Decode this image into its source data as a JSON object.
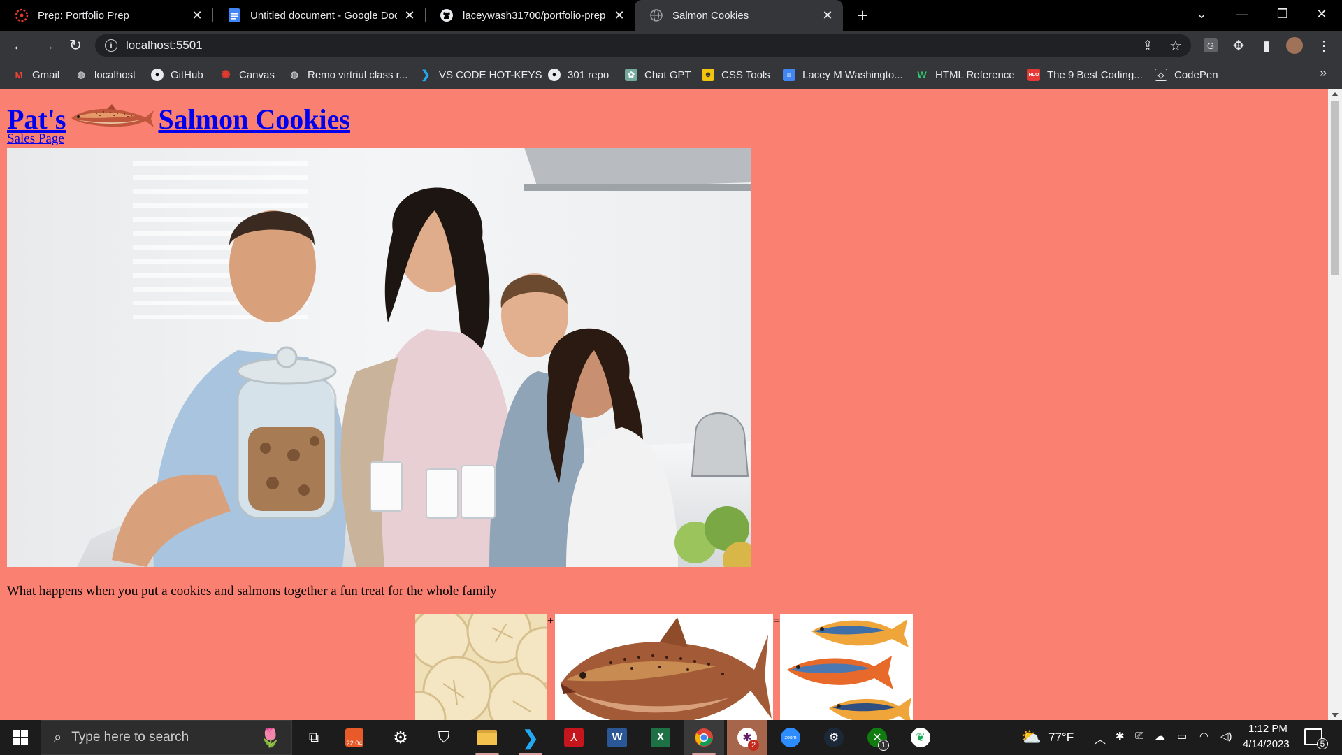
{
  "browser": {
    "tabs": [
      {
        "title": "Prep: Portfolio Prep",
        "icon": "canvas-icon",
        "active": false
      },
      {
        "title": "Untitled document - Google Doc",
        "icon": "google-docs-icon",
        "active": false
      },
      {
        "title": "laceywash31700/portfolio-prep",
        "icon": "github-icon",
        "active": false
      },
      {
        "title": "Salmon Cookies",
        "icon": "globe-icon",
        "active": true
      }
    ],
    "url": "localhost:5501",
    "bookmarks": [
      {
        "label": "Gmail",
        "icon": "gmail-icon"
      },
      {
        "label": "localhost",
        "icon": "globe-icon"
      },
      {
        "label": "GitHub",
        "icon": "github-icon"
      },
      {
        "label": "Canvas",
        "icon": "canvas-icon"
      },
      {
        "label": "Remo virtriul class r...",
        "icon": "globe-icon"
      },
      {
        "label": "VS CODE HOT-KEYS",
        "icon": "vscode-icon"
      },
      {
        "label": "301 repo",
        "icon": "github-icon"
      },
      {
        "label": "Chat GPT",
        "icon": "chatgpt-icon"
      },
      {
        "label": "CSS Tools",
        "icon": "css-tools-icon"
      },
      {
        "label": "Lacey M Washingto...",
        "icon": "google-docs-icon"
      },
      {
        "label": "HTML Reference",
        "icon": "w-icon"
      },
      {
        "label": "The 9 Best Coding...",
        "icon": "hlo-icon"
      },
      {
        "label": "CodePen",
        "icon": "codepen-icon"
      }
    ],
    "bookmarks_more": "»"
  },
  "page": {
    "title_prefix": "Pat's",
    "title_suffix": "Salmon Cookies",
    "sales_link": "Sales Page",
    "tagline": "What happens when you put a cookies and salmons together a fun treat for the whole family",
    "operator_plus": "+",
    "operator_equals": "=",
    "background_color": "#fa8072",
    "link_color": "#0000ee"
  },
  "taskbar": {
    "search_placeholder": "Type here to search",
    "weather": "77°F",
    "time": "1:12 PM",
    "date": "4/14/2023",
    "notification_count": "5",
    "badges": {
      "slack": "2",
      "xbox": "1"
    }
  }
}
